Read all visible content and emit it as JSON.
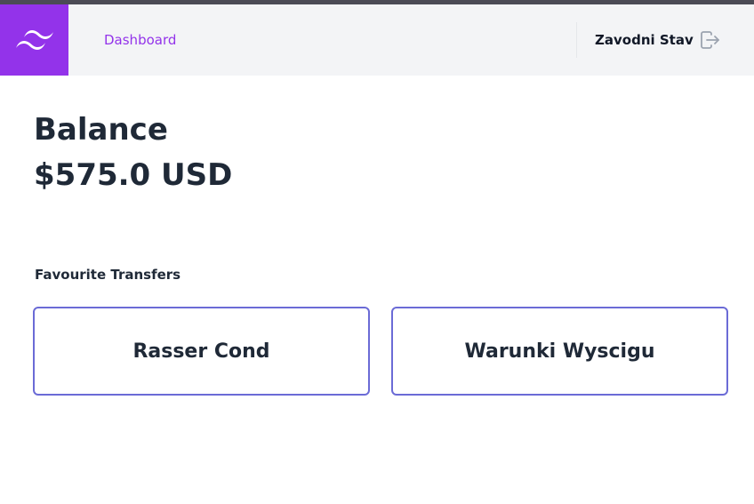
{
  "nav": {
    "logo_icon": "tailwind-wave-icon",
    "dashboard_link": "Dashboard",
    "user_name": "Zavodni Stav",
    "logout_icon": "logout-icon"
  },
  "balance": {
    "title": "Balance",
    "amount": "$575.0 USD"
  },
  "favourites": {
    "heading": "Favourite Transfers",
    "items": [
      {
        "label": "Rasser Cond"
      },
      {
        "label": "Warunki Wyscigu"
      }
    ]
  },
  "colors": {
    "accent": "#9333ea",
    "card_border": "#6b6bd6",
    "navbar_bg": "#f3f4f6",
    "text": "#1f2937"
  }
}
